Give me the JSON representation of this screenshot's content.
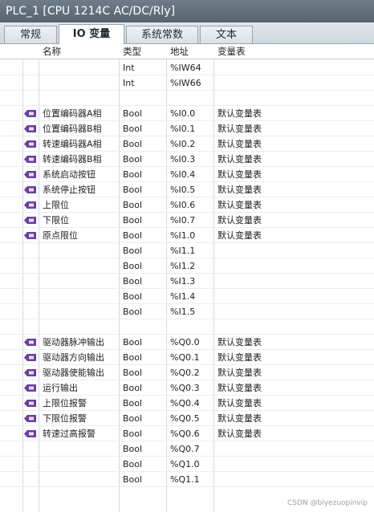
{
  "window": {
    "title": "PLC_1 [CPU 1214C AC/DC/Rly]"
  },
  "tabs": [
    {
      "label": "常规",
      "active": false
    },
    {
      "label": "IO 变量",
      "active": true
    },
    {
      "label": "系统常数",
      "active": false
    },
    {
      "label": "文本",
      "active": false
    }
  ],
  "table": {
    "columns": [
      "名称",
      "类型",
      "地址",
      "变量表"
    ],
    "rows": [
      {
        "name": "",
        "type": "Int",
        "addr": "%IW64",
        "table": "",
        "icon": ""
      },
      {
        "name": "",
        "type": "Int",
        "addr": "%IW66",
        "table": "",
        "icon": ""
      },
      {
        "name": "",
        "type": "",
        "addr": "",
        "table": "",
        "icon": ""
      },
      {
        "name": "位置编码器A相",
        "type": "Bool",
        "addr": "%I0.0",
        "table": "默认变量表",
        "icon": "plc-tag-icon"
      },
      {
        "name": "位置编码器B相",
        "type": "Bool",
        "addr": "%I0.1",
        "table": "默认变量表",
        "icon": "plc-tag-icon"
      },
      {
        "name": "转速编码器A相",
        "type": "Bool",
        "addr": "%I0.2",
        "table": "默认变量表",
        "icon": "plc-tag-icon"
      },
      {
        "name": "转速编码器B相",
        "type": "Bool",
        "addr": "%I0.3",
        "table": "默认变量表",
        "icon": "plc-tag-icon"
      },
      {
        "name": "系统启动按钮",
        "type": "Bool",
        "addr": "%I0.4",
        "table": "默认变量表",
        "icon": "plc-tag-icon"
      },
      {
        "name": "系统停止按钮",
        "type": "Bool",
        "addr": "%I0.5",
        "table": "默认变量表",
        "icon": "plc-tag-icon"
      },
      {
        "name": "上限位",
        "type": "Bool",
        "addr": "%I0.6",
        "table": "默认变量表",
        "icon": "plc-tag-icon"
      },
      {
        "name": "下限位",
        "type": "Bool",
        "addr": "%I0.7",
        "table": "默认变量表",
        "icon": "plc-tag-icon"
      },
      {
        "name": "原点限位",
        "type": "Bool",
        "addr": "%I1.0",
        "table": "默认变量表",
        "icon": "plc-tag-icon"
      },
      {
        "name": "",
        "type": "Bool",
        "addr": "%I1.1",
        "table": "",
        "icon": ""
      },
      {
        "name": "",
        "type": "Bool",
        "addr": "%I1.2",
        "table": "",
        "icon": ""
      },
      {
        "name": "",
        "type": "Bool",
        "addr": "%I1.3",
        "table": "",
        "icon": ""
      },
      {
        "name": "",
        "type": "Bool",
        "addr": "%I1.4",
        "table": "",
        "icon": ""
      },
      {
        "name": "",
        "type": "Bool",
        "addr": "%I1.5",
        "table": "",
        "icon": ""
      },
      {
        "name": "",
        "type": "",
        "addr": "",
        "table": "",
        "icon": ""
      },
      {
        "name": "驱动器脉冲输出",
        "type": "Bool",
        "addr": "%Q0.0",
        "table": "默认变量表",
        "icon": "plc-tag-icon"
      },
      {
        "name": "驱动器方向输出",
        "type": "Bool",
        "addr": "%Q0.1",
        "table": "默认变量表",
        "icon": "plc-tag-icon"
      },
      {
        "name": "驱动器使能输出",
        "type": "Bool",
        "addr": "%Q0.2",
        "table": "默认变量表",
        "icon": "plc-tag-icon"
      },
      {
        "name": "运行输出",
        "type": "Bool",
        "addr": "%Q0.3",
        "table": "默认变量表",
        "icon": "plc-tag-icon"
      },
      {
        "name": "上限位报警",
        "type": "Bool",
        "addr": "%Q0.4",
        "table": "默认变量表",
        "icon": "plc-tag-icon"
      },
      {
        "name": "下限位报警",
        "type": "Bool",
        "addr": "%Q0.5",
        "table": "默认变量表",
        "icon": "plc-tag-icon"
      },
      {
        "name": "转速过高报警",
        "type": "Bool",
        "addr": "%Q0.6",
        "table": "默认变量表",
        "icon": "plc-tag-icon"
      },
      {
        "name": "",
        "type": "Bool",
        "addr": "%Q0.7",
        "table": "",
        "icon": ""
      },
      {
        "name": "",
        "type": "Bool",
        "addr": "%Q1.0",
        "table": "",
        "icon": ""
      },
      {
        "name": "",
        "type": "Bool",
        "addr": "%Q1.1",
        "table": "",
        "icon": ""
      }
    ]
  },
  "watermark": "CSDN @biyezuopinvip",
  "colors": {
    "titlebar": "#5f6c78",
    "tag_icon": "#6a3fa0",
    "grid_line": "#d5dadf"
  }
}
